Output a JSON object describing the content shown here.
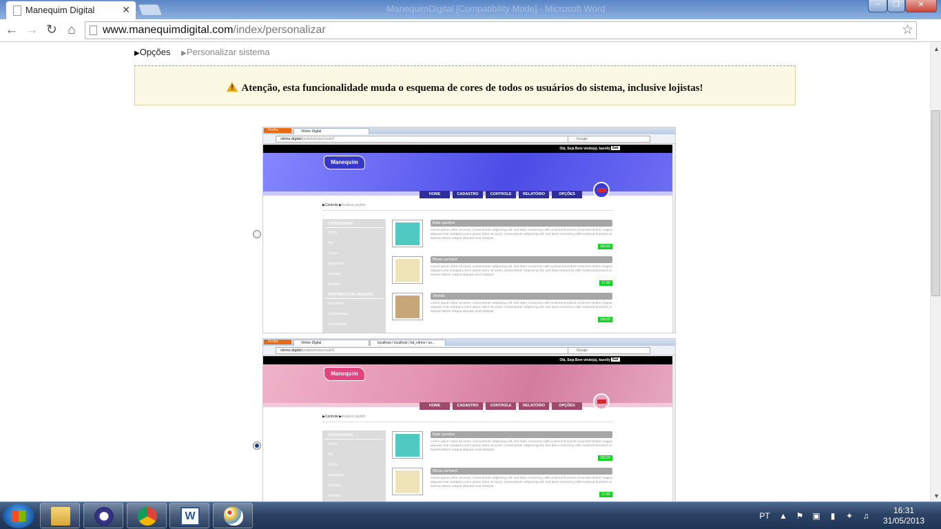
{
  "browser": {
    "window_title": "ManequimDigital [Compatibility Mode] - Microsoft Word",
    "tab_title": "Manequim Digital",
    "url_host": "www.manequimdigital.com",
    "url_path": "/index/personalizar"
  },
  "page": {
    "breadcrumb": {
      "opcoes": "Opções",
      "current": "Personalizar sistema"
    },
    "alert": "Atenção, esta funcionalidade muda o esquema de cores de todos os usuários do sistema, inclusive lojistas!",
    "themes": [
      {
        "name": "blue",
        "selected": false,
        "color": "#5a5aee"
      },
      {
        "name": "pink",
        "selected": true,
        "color": "#e394b1"
      }
    ]
  },
  "preview": {
    "firefox_label": "Firefox",
    "tab1": "Vitrine Digital",
    "tab2": "localhost / localhost / bd_vitrine / so...",
    "url_host": "vitrine.digital",
    "url_path": "/pedido/index/sub/0",
    "search_placeholder": "Google",
    "greeting": "Olá, Seja Bem vindo(a), kazolly",
    "logout": "Sair",
    "logo": "Manequim",
    "menu": [
      "HOME",
      "CADASTRO",
      "CONTROLE",
      "RELATÓRIO",
      "OPÇÕES"
    ],
    "crumb_a": "Controle",
    "crumb_b": "Realizar pedido",
    "categories_title": "CATEGORIAS",
    "categories": [
      "Todos",
      "Hm",
      "Clovis",
      "Agasalhos",
      "Camisas",
      "Vestidos"
    ],
    "history_title": "HISTÓRICO DE PEDIDOS",
    "history": [
      "Em aberto",
      "Confirmados",
      "Cancelados"
    ],
    "products": [
      {
        "name": "Bata sportine",
        "price": "150,00"
      },
      {
        "name": "Blusa cacharel",
        "price": "17,90"
      },
      {
        "name": "Vestido",
        "price": "100,00"
      }
    ],
    "lorem": "Lorem ipsum dolor sit amet, consectetuer adipiscing elit, sed diam nonummy nibh euismod tincidunt ut laoreet dolore magna aliquam erat volutpat.Lorem ipsum dolor sit amet, consectetuer adipiscing elit, sed diam nonummy nibh euismod tincidunt ut laoreet dolore magna aliquam erat volutpat."
  },
  "taskbar": {
    "lang": "PT",
    "time": "16:31",
    "date": "31/05/2013",
    "apps": [
      "explorer-icon",
      "torrent-icon",
      "chrome-icon",
      "word-icon",
      "paint-icon"
    ]
  }
}
